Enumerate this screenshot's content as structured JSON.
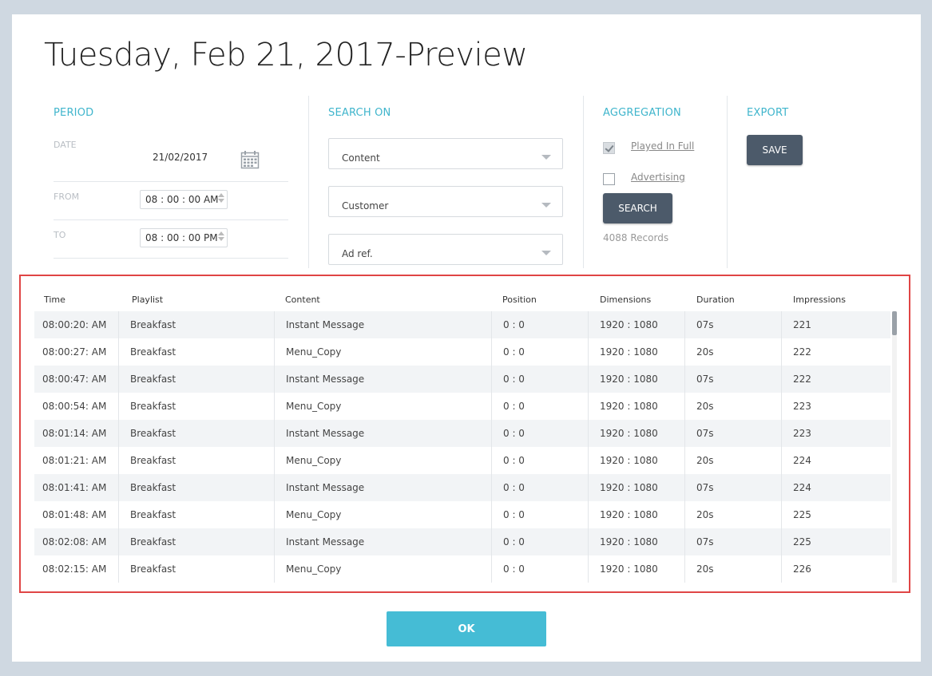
{
  "title": "Tuesday, Feb 21, 2017-Preview",
  "period": {
    "heading": "PERIOD",
    "date_label": "DATE",
    "date_value": "21/02/2017",
    "from_label": "FROM",
    "from_value": "08 : 00 : 00 AM",
    "to_label": "TO",
    "to_value": "08 : 00 : 00 PM"
  },
  "search_on": {
    "heading": "SEARCH ON",
    "selects": [
      "Content",
      "Customer",
      "Ad ref."
    ]
  },
  "aggregation": {
    "heading": "AGGREGATION",
    "played_in_full": "Played In Full",
    "played_in_full_checked": true,
    "advertising": "Advertising",
    "advertising_checked": false,
    "search_label": "SEARCH",
    "records": "4088 Records"
  },
  "export": {
    "heading": "EXPORT",
    "save_label": "SAVE"
  },
  "table": {
    "columns": [
      "Time",
      "Playlist",
      "Content",
      "Position",
      "Dimensions",
      "Duration",
      "Impressions"
    ],
    "rows": [
      [
        "08:00:20: AM",
        "Breakfast",
        "Instant Message",
        "0 : 0",
        "1920 : 1080",
        "07s",
        "221"
      ],
      [
        "08:00:27: AM",
        "Breakfast",
        "Menu_Copy",
        "0 : 0",
        "1920 : 1080",
        "20s",
        "222"
      ],
      [
        "08:00:47: AM",
        "Breakfast",
        "Instant Message",
        "0 : 0",
        "1920 : 1080",
        "07s",
        "222"
      ],
      [
        "08:00:54: AM",
        "Breakfast",
        "Menu_Copy",
        "0 : 0",
        "1920 : 1080",
        "20s",
        "223"
      ],
      [
        "08:01:14: AM",
        "Breakfast",
        "Instant Message",
        "0 : 0",
        "1920 : 1080",
        "07s",
        "223"
      ],
      [
        "08:01:21: AM",
        "Breakfast",
        "Menu_Copy",
        "0 : 0",
        "1920 : 1080",
        "20s",
        "224"
      ],
      [
        "08:01:41: AM",
        "Breakfast",
        "Instant Message",
        "0 : 0",
        "1920 : 1080",
        "07s",
        "224"
      ],
      [
        "08:01:48: AM",
        "Breakfast",
        "Menu_Copy",
        "0 : 0",
        "1920 : 1080",
        "20s",
        "225"
      ],
      [
        "08:02:08: AM",
        "Breakfast",
        "Instant Message",
        "0 : 0",
        "1920 : 1080",
        "07s",
        "225"
      ],
      [
        "08:02:15: AM",
        "Breakfast",
        "Menu_Copy",
        "0 : 0",
        "1920 : 1080",
        "20s",
        "226"
      ]
    ]
  },
  "ok_label": "OK",
  "colors": {
    "accent": "#45bcd5",
    "dark_button": "#4c5a6a",
    "highlight_border": "#e04545"
  },
  "icons": [
    "calendar-icon",
    "chevron-down-icon",
    "checkmark-icon",
    "spinner-arrows-icon"
  ]
}
